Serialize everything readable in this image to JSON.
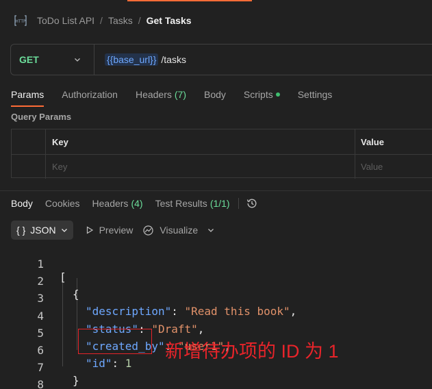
{
  "breadcrumb": {
    "collection": "ToDo List API",
    "folder": "Tasks",
    "request": "Get Tasks",
    "separator": "/",
    "icon": "http-icon"
  },
  "request": {
    "method": "GET",
    "url_variable": "{{base_url}}",
    "url_path": "/tasks"
  },
  "request_tabs": [
    {
      "label": "Params",
      "active": true
    },
    {
      "label": "Authorization"
    },
    {
      "label": "Headers",
      "count": "(7)"
    },
    {
      "label": "Body"
    },
    {
      "label": "Scripts",
      "dot": true
    },
    {
      "label": "Settings"
    }
  ],
  "query_params": {
    "title": "Query Params",
    "key_header": "Key",
    "value_header": "Value",
    "key_placeholder": "Key",
    "value_placeholder": "Value"
  },
  "response_tabs": [
    {
      "label": "Body",
      "active": true
    },
    {
      "label": "Cookies"
    },
    {
      "label": "Headers",
      "count": "(4)"
    },
    {
      "label": "Test Results",
      "count": "(1/1)"
    }
  ],
  "response_toolbar": {
    "format_icon": "{ }",
    "format": "JSON",
    "preview": "Preview",
    "visualize": "Visualize"
  },
  "code": {
    "line_numbers": [
      "1",
      "2",
      "3",
      "4",
      "5",
      "6",
      "7",
      "8"
    ],
    "open_bracket": "[",
    "open_brace": "{",
    "close_brace": "}",
    "close_bracket": "]",
    "fields": [
      {
        "key": "\"description\"",
        "value": "\"Read this book\"",
        "type": "string",
        "comma": ","
      },
      {
        "key": "\"status\"",
        "value": "\"Draft\"",
        "type": "string",
        "comma": ","
      },
      {
        "key": "\"created_by\"",
        "value": "\"user1\"",
        "type": "string",
        "comma": ","
      },
      {
        "key": "\"id\"",
        "value": "1",
        "type": "number",
        "comma": ""
      }
    ]
  },
  "annotation": "新增待办项的 ID 为 1",
  "colors": {
    "accent": "#ff6c37",
    "method_get": "#6bdd9a",
    "json_key": "#6ea8ff",
    "json_string": "#e2926a",
    "annotation": "#e8242a"
  }
}
